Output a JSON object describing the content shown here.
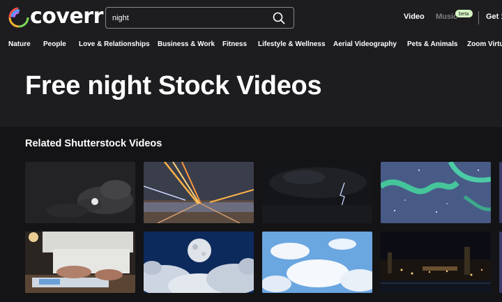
{
  "header": {
    "logo_text": "coverr",
    "search": {
      "value": "night",
      "placeholder": ""
    },
    "nav": {
      "video": "Video",
      "music": "Music",
      "beta": "beta",
      "get": "Get 1"
    }
  },
  "categories": [
    "Nature",
    "People",
    "Love & Relationships",
    "Business & Work",
    "Fitness",
    "Lifestyle & Wellness",
    "Aerial Videography",
    "Pets & Animals",
    "Zoom Virtu"
  ],
  "hero": {
    "title": "Free night Stock Videos"
  },
  "section": {
    "title": "Related Shutterstock Videos"
  },
  "thumbnails": [
    "moon-clouds-dark",
    "light-trails-road",
    "lightning-storm-sea",
    "aurora-starry-sky",
    "business-hands-laptop",
    "full-moon-above-clouds",
    "blue-sky-white-clouds",
    "city-night-skyline"
  ],
  "icons": {
    "search": "search-icon",
    "logo": "coverr-logo-icon"
  },
  "colors": {
    "background": "#1d1d20",
    "section": "#141416",
    "beta_badge": "#d6f7c4",
    "muted": "#7e7e80"
  }
}
